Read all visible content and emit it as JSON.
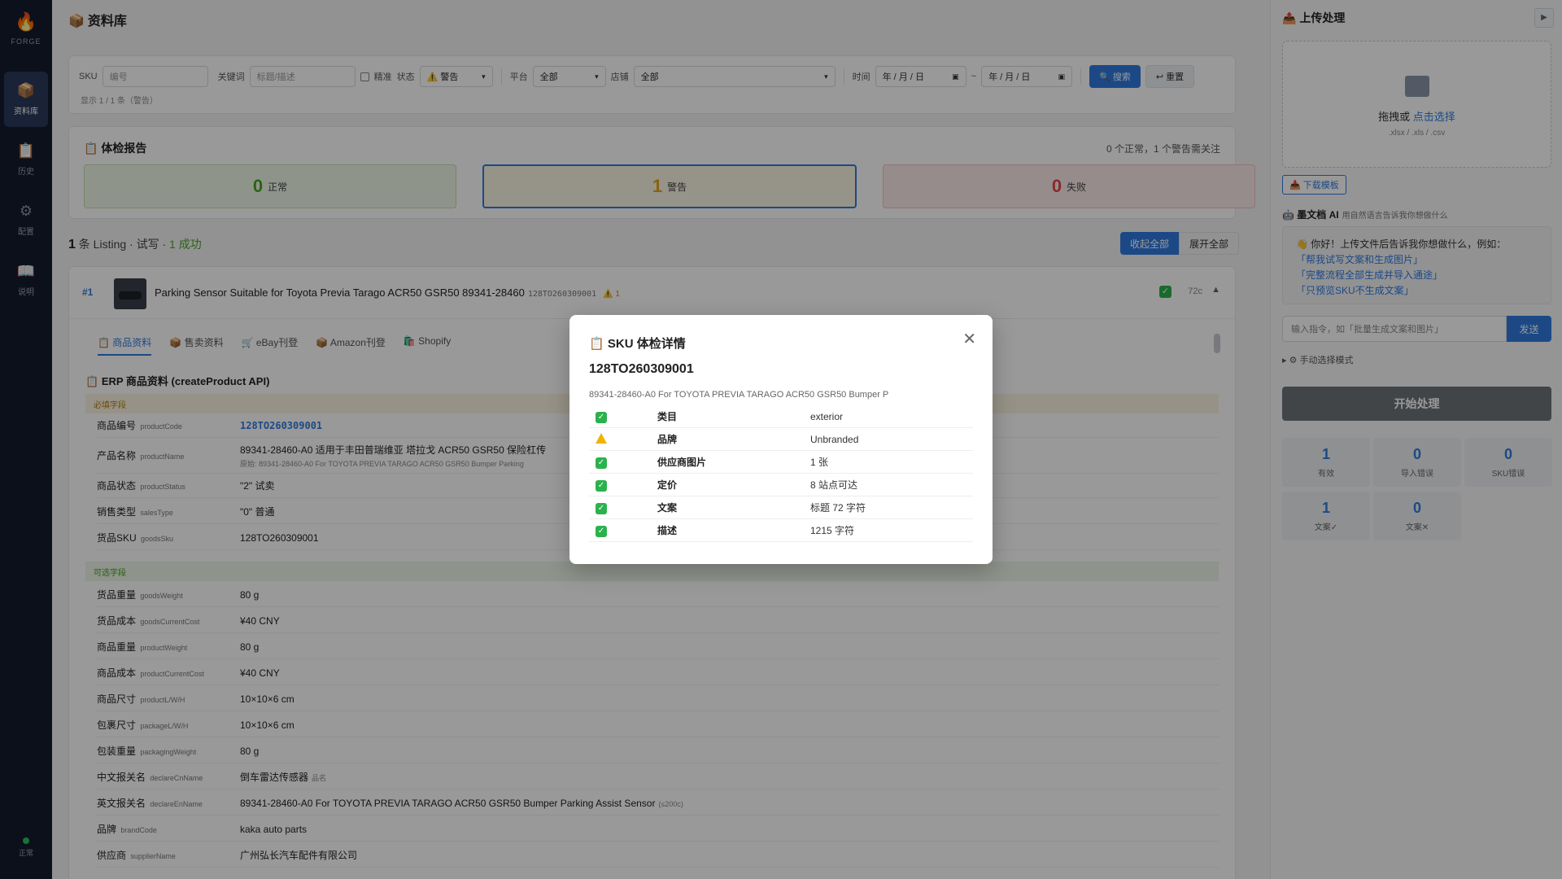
{
  "rail": {
    "brand": "FORGE",
    "items": [
      {
        "label": "资料库"
      },
      {
        "label": "历史"
      },
      {
        "label": "配置"
      },
      {
        "label": "说明"
      }
    ],
    "status": "正常"
  },
  "main": {
    "title": "资料库",
    "filter": {
      "sku_label": "SKU",
      "sku_placeholder": "编号",
      "keyword_label": "关键词",
      "keyword_placeholder": "标题/描述",
      "exact_label": "精准",
      "status_label": "状态",
      "status_value": "⚠️ 警告",
      "platform_label": "平台",
      "platform_value": "全部",
      "store_label": "店铺",
      "store_value": "全部",
      "time_label": "时间",
      "date_from": "年 / 月 / 日",
      "date_sep": "~",
      "date_to": "年 / 月 / 日",
      "search_btn": "🔍 搜索",
      "reset_btn": "↩ 重置",
      "hint": "显示 1 / 1 条（警告）"
    },
    "report": {
      "title": "体检报告",
      "summary": "0 个正常，1 个警告需关注",
      "ok_num": "0",
      "ok_label": "正常",
      "warn_num": "1",
      "warn_label": "警告",
      "fail_num": "0",
      "fail_label": "失败"
    },
    "listing_summary": {
      "count": "1",
      "text": " 条 Listing · 试写 · ",
      "success": "1 成功"
    },
    "collapse_all": "收起全部",
    "expand_all": "展开全部",
    "listing": {
      "index": "#1",
      "title": "Parking Sensor Suitable for Toyota Previa Tarago ACR50 GSR50 89341-28460",
      "sku": "128TO260309001",
      "warn": "⚠️ 1",
      "chars": "72c",
      "tabs": [
        "商品资料",
        "售卖资料",
        "eBay刊登",
        "Amazon刊登",
        "Shopify"
      ],
      "erp_title": "ERP 商品资料 (createProduct API)",
      "required_label": "必填字段",
      "optional_label": "可选字段",
      "fields_required": [
        {
          "k": "商品编号",
          "s": "productCode",
          "v": "128TO260309001"
        },
        {
          "k": "产品名称",
          "s": "productName",
          "v": "89341-28460-A0 适用于丰田普瑞维亚 塔拉戈 ACR50 GSR50 保险杠传",
          "sub": "原始: 89341-28460-A0 For TOYOTA PREVIA TARAGO ACR50 GSR50 Bumper Parking"
        },
        {
          "k": "商品状态",
          "s": "productStatus",
          "v": "\"2\" 试卖"
        },
        {
          "k": "销售类型",
          "s": "salesType",
          "v": "\"0\" 普通"
        },
        {
          "k": "货品SKU",
          "s": "goodsSku",
          "v": "128TO260309001"
        }
      ],
      "fields_optional": [
        {
          "k": "货品重量",
          "s": "goodsWeight",
          "v": "80 g"
        },
        {
          "k": "货品成本",
          "s": "goodsCurrentCost",
          "v": "¥40 CNY"
        },
        {
          "k": "商品重量",
          "s": "productWeight",
          "v": "80 g"
        },
        {
          "k": "商品成本",
          "s": "productCurrentCost",
          "v": "¥40 CNY"
        },
        {
          "k": "商品尺寸",
          "s": "productL/W/H",
          "v": "10×10×6 cm"
        },
        {
          "k": "包裹尺寸",
          "s": "packageL/W/H",
          "v": "10×10×6 cm"
        },
        {
          "k": "包装重量",
          "s": "packagingWeight",
          "v": "80 g"
        },
        {
          "k": "中文报关名",
          "s": "declareCnName",
          "v": "倒车雷达传感器",
          "hint": "品名"
        },
        {
          "k": "英文报关名",
          "s": "declareEnName",
          "v": "89341-28460-A0 For TOYOTA PREVIA TARAGO ACR50 GSR50 Bumper Parking Assist Sensor",
          "hint": "(≤200c)"
        },
        {
          "k": "品牌",
          "s": "brandCode",
          "v": "kaka auto parts"
        },
        {
          "k": "供应商",
          "s": "supplierName",
          "v": "广州弘长汽车配件有限公司"
        }
      ]
    }
  },
  "right": {
    "title": "上传处理",
    "drop_text": "拖拽或 ",
    "drop_link": "点击选择",
    "drop_ext": ".xlsx / .xls / .csv",
    "download_btn": "📥 下载模板",
    "ai_title": "墨文档 AI",
    "ai_subtitle": "用自然语言告诉我你想做什么",
    "ai_greeting": "👋 你好！上传文件后告诉我你想做什么，例如：",
    "ai_suggestions": [
      "「帮我试写文案和生成图片」",
      "「完整流程全部生成并导入通途」",
      "「只预览SKU不生成文案」"
    ],
    "ai_placeholder": "输入指令，如「批量生成文案和图片」",
    "send_btn": "发送",
    "manual_mode": "▸ ⚙ 手动选择模式",
    "start_btn": "开始处理",
    "counters": [
      {
        "n": "1",
        "l": "有效"
      },
      {
        "n": "0",
        "l": "导入错误"
      },
      {
        "n": "0",
        "l": "SKU错误"
      },
      {
        "n": "1",
        "l": "文案✓"
      },
      {
        "n": "0",
        "l": "文案✕"
      }
    ]
  },
  "modal": {
    "title": "SKU 体检详情",
    "sku": "128TO260309001",
    "name": "89341-28460-A0 For TOYOTA PREVIA TARAGO ACR50 GSR50 Bumper P",
    "rows": [
      {
        "status": "ok",
        "label": "类目",
        "value": "exterior"
      },
      {
        "status": "warn",
        "label": "品牌",
        "value": "Unbranded"
      },
      {
        "status": "ok",
        "label": "供应商图片",
        "value": "1 张"
      },
      {
        "status": "ok",
        "label": "定价",
        "value": "8 站点可达"
      },
      {
        "status": "ok",
        "label": "文案",
        "value": "标题 72 字符"
      },
      {
        "status": "ok",
        "label": "描述",
        "value": "1215 字符"
      }
    ]
  },
  "colors": {
    "accent": "#2f7be0",
    "ok": "#4aa61f",
    "warn": "#e3a31b",
    "fail": "#e24848",
    "rail": "#141c2c"
  }
}
